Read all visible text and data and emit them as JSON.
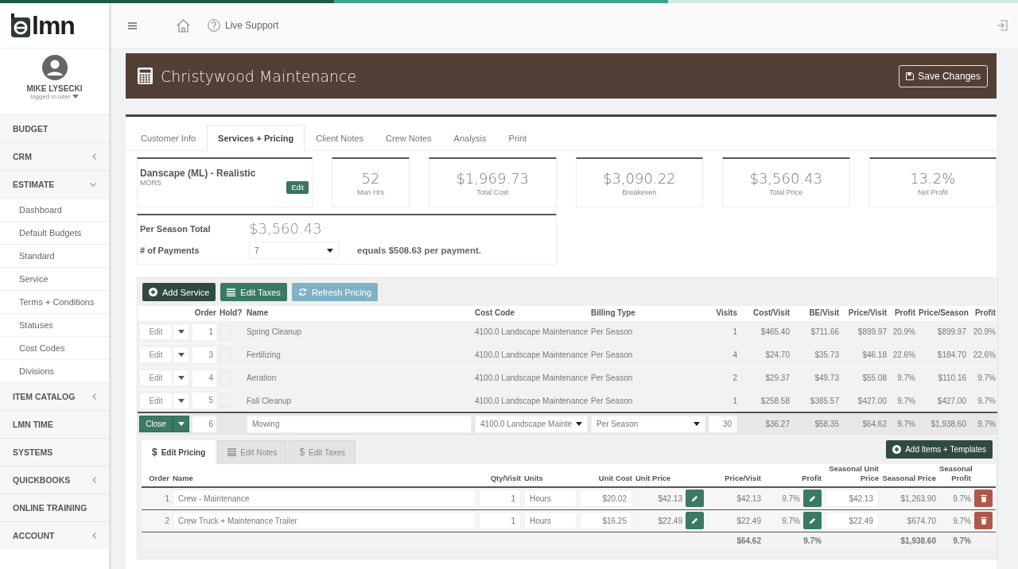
{
  "logo": {
    "text": "lmn"
  },
  "topbar": {
    "live_support": "Live Support"
  },
  "user": {
    "name": "MIKE LYSECKI",
    "role": "logged in user"
  },
  "sidebar": {
    "items": [
      {
        "label": "BUDGET",
        "kind": "link"
      },
      {
        "label": "CRM",
        "kind": "group",
        "expanded": false
      },
      {
        "label": "ESTIMATE",
        "kind": "group",
        "expanded": true,
        "children": [
          {
            "label": "Dashboard"
          },
          {
            "label": "Default Budgets"
          },
          {
            "label": "Standard"
          },
          {
            "label": "Service"
          },
          {
            "label": "Terms + Conditions"
          },
          {
            "label": "Statuses"
          },
          {
            "label": "Cost Codes"
          },
          {
            "label": "Divisions"
          }
        ]
      },
      {
        "label": "ITEM CATALOG",
        "kind": "group",
        "expanded": false
      },
      {
        "label": "LMN TIME",
        "kind": "link"
      },
      {
        "label": "SYSTEMS",
        "kind": "link"
      },
      {
        "label": "QUICKBOOKS",
        "kind": "group",
        "expanded": false
      },
      {
        "label": "ONLINE TRAINING",
        "kind": "link"
      },
      {
        "label": "ACCOUNT",
        "kind": "group",
        "expanded": false
      }
    ]
  },
  "header": {
    "title": "Christywood Maintenance",
    "save_button": "Save Changes"
  },
  "tabs": [
    {
      "label": "Customer Info",
      "selected": false
    },
    {
      "label": "Services + Pricing",
      "selected": true
    },
    {
      "label": "Client Notes",
      "selected": false
    },
    {
      "label": "Crew Notes",
      "selected": false
    },
    {
      "label": "Analysis",
      "selected": false
    },
    {
      "label": "Print",
      "selected": false
    }
  ],
  "template_card": {
    "name": "Danscape (ML) - Realistic",
    "code": "MORS",
    "edit_button": "Edit"
  },
  "stats": [
    {
      "value": "52",
      "label": "Man Hrs"
    },
    {
      "value": "$1,969.73",
      "label": "Total Cost"
    },
    {
      "value": "$3,090.22",
      "label": "Breakeven"
    },
    {
      "value": "$3,560.43",
      "label": "Total Price"
    },
    {
      "value": "13.2%",
      "label": "Net Profit"
    }
  ],
  "season": {
    "total_label": "Per Season Total",
    "total": "$3,560.43",
    "payments_label": "# of Payments",
    "payments": "7",
    "per_payment": "equals $508.63 per payment."
  },
  "toolbar": [
    {
      "label": "Add Service",
      "kind": "add",
      "disabled": false
    },
    {
      "label": "Edit Taxes",
      "kind": "taxes",
      "disabled": false
    },
    {
      "label": "Refresh Pricing",
      "kind": "refresh",
      "disabled": true
    }
  ],
  "services": {
    "columns": [
      "Order",
      "Hold?",
      "Name",
      "Cost Code",
      "Billing Type",
      "Visits",
      "Cost/Visit",
      "BE/Visit",
      "Price/Visit",
      "Profit",
      "Price/Season",
      "Profit"
    ],
    "rows": [
      {
        "action": "Edit",
        "expanded": false,
        "order": "1",
        "hold": false,
        "name": "Spring Cleanup",
        "cost_code": "4100.0 Landscape Maintenance",
        "billing_type": "Per Season",
        "visits": "1",
        "cost_visit": "$465.40",
        "be_visit": "$711.66",
        "price_visit": "$899.97",
        "profit_visit": "20.9%",
        "price_season": "$899.97",
        "profit_season": "20.9%"
      },
      {
        "action": "Edit",
        "expanded": false,
        "order": "3",
        "hold": false,
        "name": "Fertilizing",
        "cost_code": "4100.0 Landscape Maintenance",
        "billing_type": "Per Season",
        "visits": "4",
        "cost_visit": "$24.70",
        "be_visit": "$35.73",
        "price_visit": "$46.18",
        "profit_visit": "22.6%",
        "price_season": "$184.70",
        "profit_season": "22.6%"
      },
      {
        "action": "Edit",
        "expanded": false,
        "order": "4",
        "hold": false,
        "name": "Aeration",
        "cost_code": "4100.0 Landscape Maintenance",
        "billing_type": "Per Season",
        "visits": "2",
        "cost_visit": "$29.37",
        "be_visit": "$49.73",
        "price_visit": "$55.08",
        "profit_visit": "9.7%",
        "price_season": "$110.16",
        "profit_season": "9.7%"
      },
      {
        "action": "Edit",
        "expanded": false,
        "order": "5",
        "hold": false,
        "name": "Fall Cleanup",
        "cost_code": "4100.0 Landscape Maintenance",
        "billing_type": "Per Season",
        "visits": "1",
        "cost_visit": "$258.58",
        "be_visit": "$385.57",
        "price_visit": "$427.00",
        "profit_visit": "9.7%",
        "price_season": "$427.00",
        "profit_season": "9.7%"
      },
      {
        "action": "Close",
        "expanded": true,
        "order": "6",
        "hold": false,
        "name": "Mowing",
        "cost_code": "4100.0 Landscape Mainte",
        "billing_type": "Per Season",
        "visits": "30",
        "cost_visit": "$36.27",
        "be_visit": "$58.35",
        "price_visit": "$64.62",
        "profit_visit": "9.7%",
        "price_season": "$1,938.60",
        "profit_season": "9.7%"
      }
    ]
  },
  "detail": {
    "tabs": [
      {
        "label": "Edit Pricing",
        "kind": "pricing",
        "symbol": "$",
        "selected": true
      },
      {
        "label": "Edit Notes",
        "kind": "notes",
        "selected": false
      },
      {
        "label": "Edit Taxes",
        "kind": "taxes",
        "symbol": "$",
        "selected": false
      }
    ],
    "add_button": "Add Items + Templates",
    "columns": [
      "Order",
      "Name",
      "Qty/Visit",
      "Units",
      "Unit Cost",
      "Unit Price",
      "Price/Visit",
      "Profit",
      "Seasonal Unit Price",
      "Seasonal Price",
      "Seasonal Profit"
    ],
    "rows": [
      {
        "order": "1",
        "name": "Crew - Maintenance",
        "qty": "1",
        "units": "Hours",
        "unit_cost": "$20.02",
        "unit_price": "$42.13",
        "price_visit": "$42.13",
        "profit": "9.7%",
        "seasonal_unit_price": "$42.13",
        "seasonal_price": "$1,263.90",
        "seasonal_profit": "9.7%"
      },
      {
        "order": "2",
        "name": "Crew Truck + Maintenance Trailer",
        "qty": "1",
        "units": "Hours",
        "unit_cost": "$16.25",
        "unit_price": "$22.49",
        "price_visit": "$22.49",
        "profit": "9.7%",
        "seasonal_unit_price": "$22.49",
        "seasonal_price": "$674.70",
        "seasonal_profit": "9.7%"
      }
    ],
    "totals": {
      "price_visit": "$64.62",
      "profit": "9.7%",
      "seasonal_price": "$1,938.60",
      "seasonal_profit": "9.7%"
    }
  }
}
